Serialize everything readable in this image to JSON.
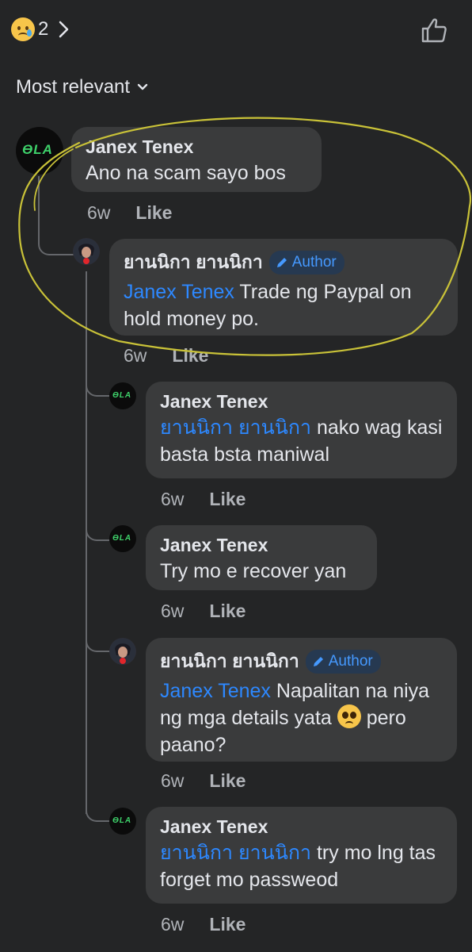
{
  "header": {
    "reaction_emoji": "sad-face-with-tear",
    "reaction_count": "2",
    "sort_label": "Most relevant"
  },
  "comments": [
    {
      "name": "Janex Tenex",
      "text": "Ano na scam sayo bos",
      "time": "6w",
      "like": "Like"
    },
    {
      "name": "ยานนิกา ยานนิกา",
      "badge": "Author",
      "mention": "Janex Tenex",
      "text": " Trade ng Paypal on hold money po.",
      "time": "6w",
      "like": "Like"
    },
    {
      "name": "Janex Tenex",
      "mention": "ยานนิกา ยานนิกา",
      "text": " nako wag kasi basta bsta maniwal",
      "time": "6w",
      "like": "Like"
    },
    {
      "name": "Janex Tenex",
      "text": "Try mo e recover yan",
      "time": "6w",
      "like": "Like"
    },
    {
      "name": "ยานนิกา ยานนิกา",
      "badge": "Author",
      "mention": "Janex Tenex",
      "text": " Napalitan na niya ng mga details yata ",
      "text_after_emoji": "pero paano?",
      "time": "6w",
      "like": "Like"
    },
    {
      "name": "Janex Tenex",
      "mention": "ยานนิกา ยานนิกา",
      "text": " try mo lng tas forget mo passweod",
      "time": "6w",
      "like": "Like"
    }
  ],
  "avatar_text": "ƟLA",
  "colors": {
    "background": "#242526",
    "bubble": "#3a3b3c",
    "mention": "#2d88ff",
    "annotation": "#c9c238"
  }
}
